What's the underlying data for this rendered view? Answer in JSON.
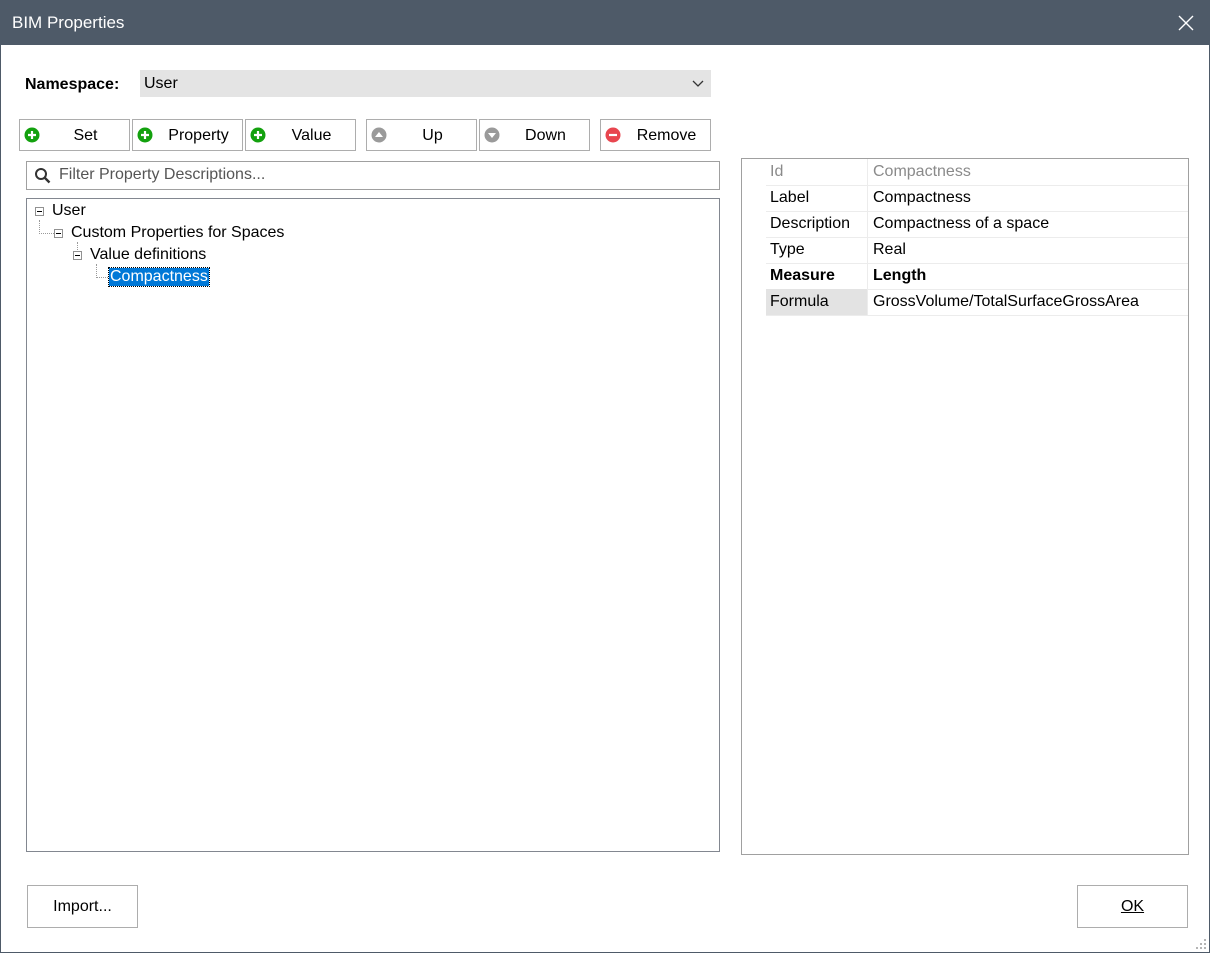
{
  "window": {
    "title": "BIM Properties"
  },
  "namespace": {
    "label": "Namespace:",
    "value": "User"
  },
  "toolbar": {
    "set": "Set",
    "property": "Property",
    "value": "Value",
    "up": "Up",
    "down": "Down",
    "remove": "Remove"
  },
  "filter": {
    "placeholder": "Filter Property Descriptions..."
  },
  "tree": {
    "root": "User",
    "child": "Custom Properties for Spaces",
    "grandchild": "Value definitions",
    "leaf": "Compactness"
  },
  "properties": [
    {
      "key": "Id",
      "value": "Compactness"
    },
    {
      "key": "Label",
      "value": "Compactness"
    },
    {
      "key": "Description",
      "value": "Compactness of a space"
    },
    {
      "key": "Type",
      "value": "Real"
    },
    {
      "key": "Measure",
      "value": "Length"
    },
    {
      "key": "Formula",
      "value": "GrossVolume/TotalSurfaceGrossArea"
    }
  ],
  "footer": {
    "import": "Import...",
    "ok": "OK"
  },
  "icons": {
    "close": "close-icon",
    "dropdown": "chevron-down-icon",
    "add": "plus-circle-icon",
    "up": "arrow-up-circle-icon",
    "down": "arrow-down-circle-icon",
    "remove": "minus-circle-icon",
    "search": "search-icon",
    "tree_collapse": "minus-box-icon",
    "resize": "resize-grip-icon"
  },
  "colors": {
    "titlebar": "#4e5a68",
    "selection": "#0078d7",
    "add_green": "#13a10e",
    "remove_red": "#e8464f",
    "disabled_gray": "#9a9a9a"
  }
}
